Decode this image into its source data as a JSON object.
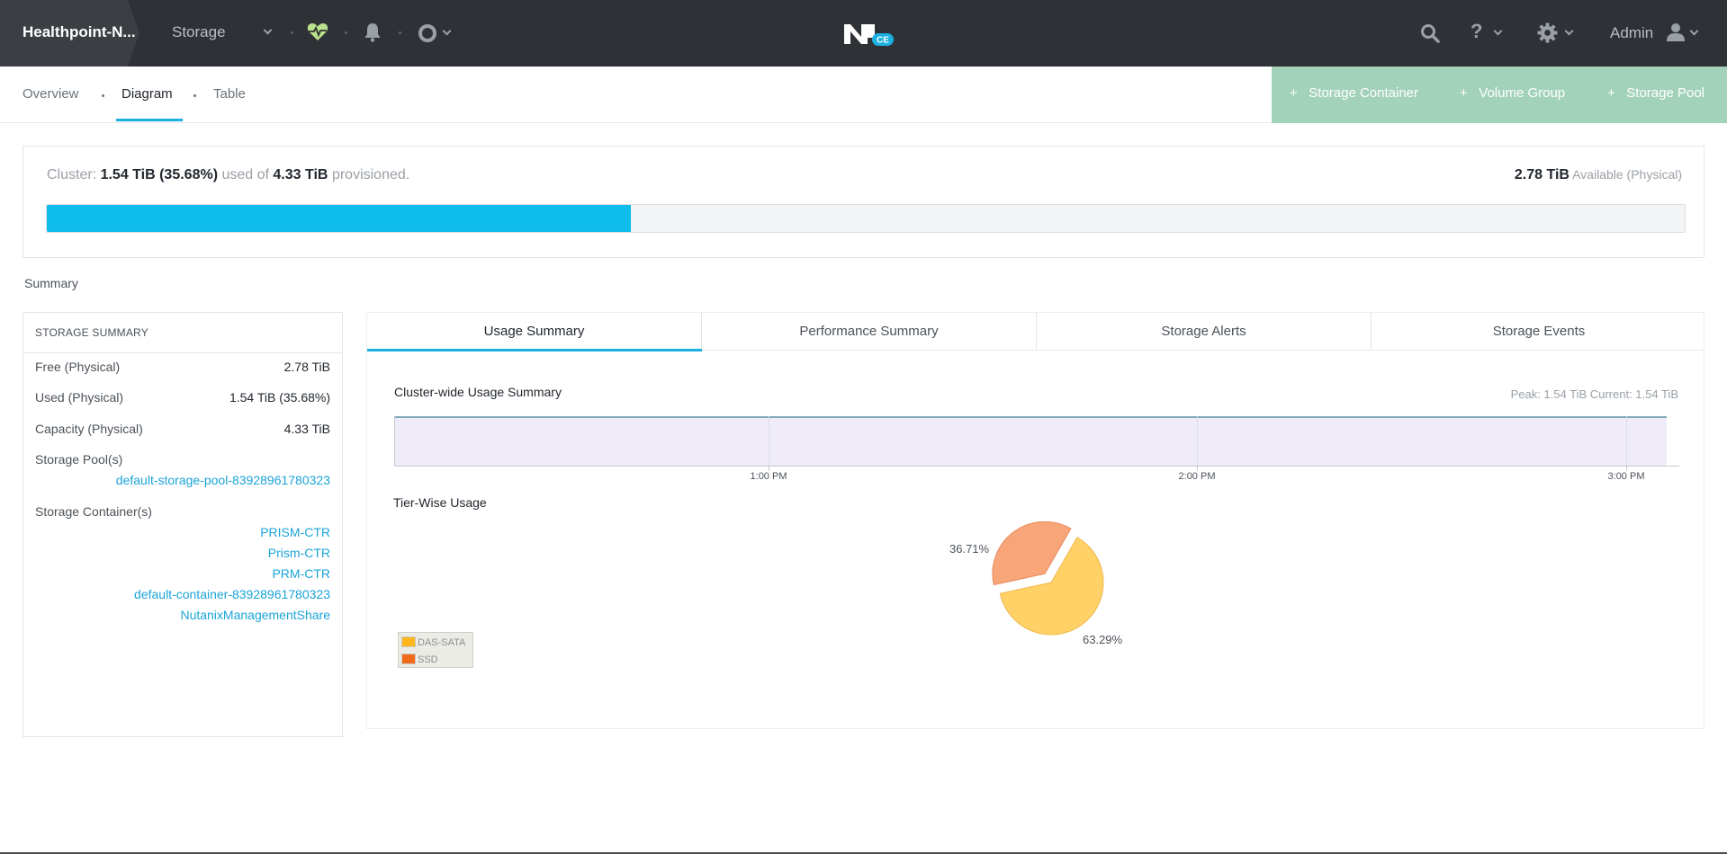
{
  "topbar": {
    "cluster_name": "Healthpoint-N...",
    "section": "Storage",
    "logo_badge": "CE",
    "help_label": "?",
    "user_label": "Admin"
  },
  "subnav": {
    "tabs": [
      {
        "label": "Overview"
      },
      {
        "label": "Diagram"
      },
      {
        "label": "Table"
      }
    ],
    "active_tab": "Diagram",
    "actions": [
      {
        "label": "Storage Container"
      },
      {
        "label": "Volume Group"
      },
      {
        "label": "Storage Pool"
      }
    ]
  },
  "cluster_usage": {
    "prefix": "Cluster:",
    "used": "1.54 TiB (35.68%)",
    "used_of_text": "used of",
    "provisioned": "4.33 TiB",
    "provisioned_text": "provisioned.",
    "available_value": "2.78 TiB",
    "available_text": "Available (Physical)",
    "used_fraction": 0.3568
  },
  "summary_label": "Summary",
  "storage_summary": {
    "title": "STORAGE SUMMARY",
    "rows": [
      {
        "label": "Free (Physical)",
        "value": "2.78 TiB"
      },
      {
        "label": "Used (Physical)",
        "value": "1.54 TiB (35.68%)"
      },
      {
        "label": "Capacity (Physical)",
        "value": "4.33 TiB"
      }
    ],
    "pools_label": "Storage Pool(s)",
    "pools": [
      "default-storage-pool-83928961780323"
    ],
    "containers_label": "Storage Container(s)",
    "containers": [
      "PRISM-CTR",
      "Prism-CTR",
      "PRM-CTR",
      "default-container-83928961780323",
      "NutanixManagementShare"
    ]
  },
  "panel": {
    "tabs": [
      {
        "label": "Usage Summary"
      },
      {
        "label": "Performance Summary"
      },
      {
        "label": "Storage Alerts"
      },
      {
        "label": "Storage Events"
      }
    ],
    "active_tab": "Usage Summary",
    "cluster_wide_title": "Cluster-wide Usage Summary",
    "peak_text": "Peak: 1.54 TiB  Current: 1.54 TiB",
    "time_labels": [
      "1:00 PM",
      "2:00 PM",
      "3:00 PM"
    ],
    "tier_title": "Tier-Wise Usage"
  },
  "chart_data": [
    {
      "type": "area",
      "title": "Cluster-wide Usage Summary",
      "x": [
        "1:00 PM",
        "2:00 PM",
        "3:00 PM"
      ],
      "series": [
        {
          "values": [
            1.54,
            1.54,
            1.54
          ]
        }
      ],
      "peak": "1.54 TiB",
      "current": "1.54 TiB"
    },
    {
      "type": "pie",
      "title": "Tier-Wise Usage",
      "categories": [
        "DAS-SATA",
        "SSD"
      ],
      "values": [
        63.29,
        36.71
      ],
      "labels": [
        "63.29%",
        "36.71%"
      ],
      "colors": [
        "#ffd166",
        "#f8a57a"
      ],
      "legend_colors": [
        "#ffb61f",
        "#f06a1a"
      ],
      "legend": "bottom-left"
    }
  ],
  "colors": {
    "topbar": "#2e3236",
    "accent": "#1bb0e0",
    "usage_bar": "#0ebde9",
    "actions_bg": "#a3d2bb",
    "link": "#1ba4d8"
  }
}
